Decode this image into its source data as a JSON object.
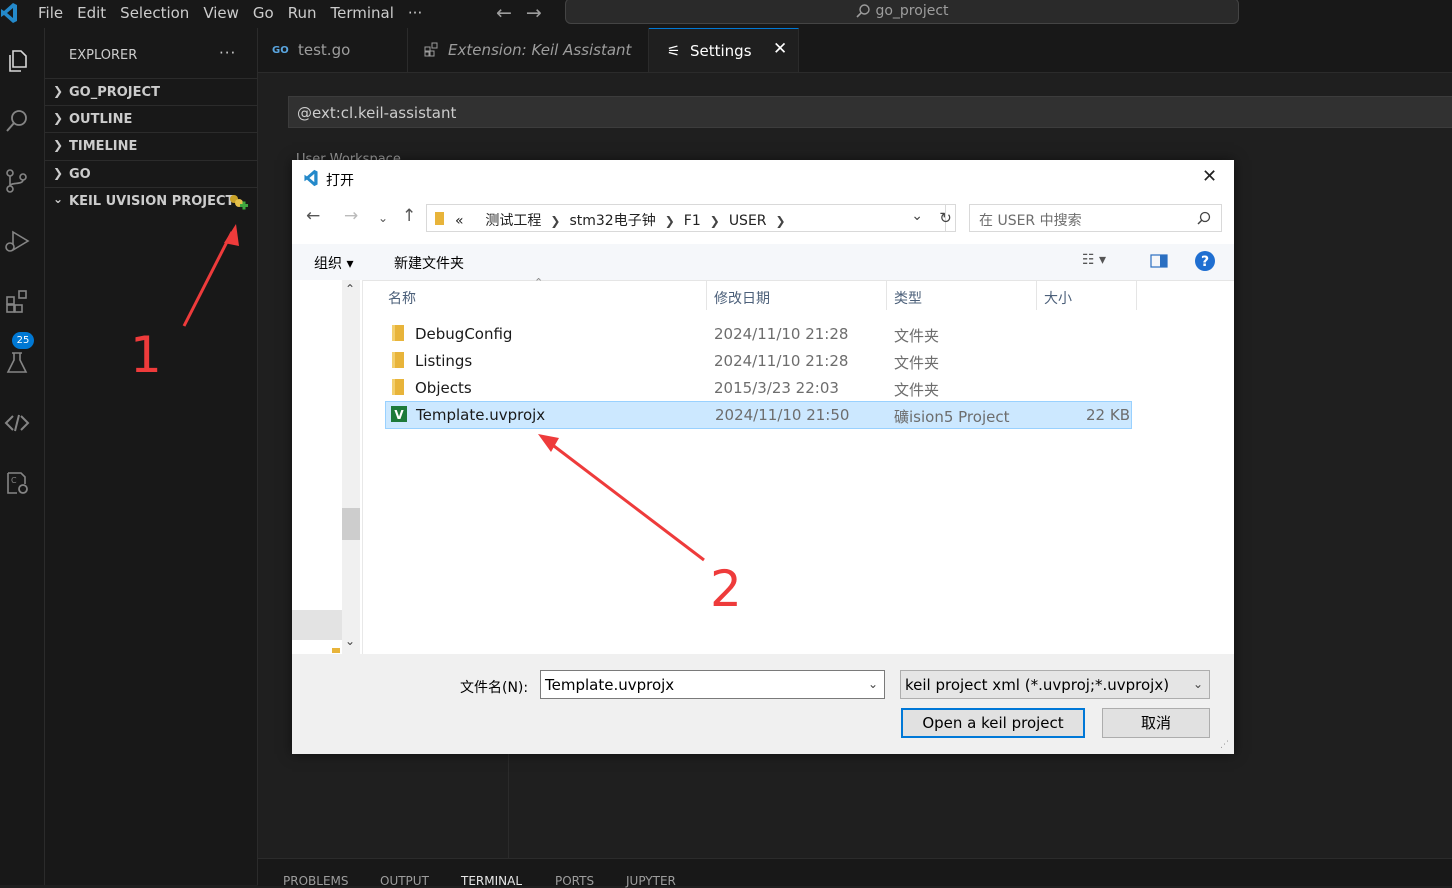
{
  "window": {
    "menu": [
      "File",
      "Edit",
      "Selection",
      "View",
      "Go",
      "Run",
      "Terminal",
      "···"
    ],
    "command_center": "go_project"
  },
  "activity": {
    "extensions_badge": "25"
  },
  "sidebar": {
    "title": "EXPLORER",
    "more": "···",
    "sections": [
      "GO_PROJECT",
      "OUTLINE",
      "TIMELINE",
      "GO",
      "KEIL UVISION PROJECT"
    ]
  },
  "tabs": [
    {
      "label": "test.go",
      "icon": "go-file-icon"
    },
    {
      "label": "Extension: Keil Assistant",
      "icon": "extension-icon"
    },
    {
      "label": "Settings",
      "icon": "settings-icon"
    }
  ],
  "settings": {
    "search_value": "@ext:cl.keil-assistant",
    "scope": "User    Workspace"
  },
  "panel": {
    "tabs": [
      "PROBLEMS",
      "OUTPUT",
      "TERMINAL",
      "PORTS",
      "JUPYTER"
    ],
    "active": "TERMINAL"
  },
  "dialog": {
    "title": "打开",
    "breadcrumbs": [
      "«",
      "测试工程",
      "stm32电子钟",
      "F1",
      "USER"
    ],
    "search_placeholder": "在 USER 中搜索",
    "toolbar": {
      "organize": "组织 ▾",
      "new_folder": "新建文件夹"
    },
    "columns": {
      "name": "名称",
      "modified": "修改日期",
      "type": "类型",
      "size": "大小"
    },
    "files": [
      {
        "name": "DebugConfig",
        "modified": "2024/11/10 21:28",
        "type": "文件夹",
        "size": "",
        "kind": "folder"
      },
      {
        "name": "Listings",
        "modified": "2024/11/10 21:28",
        "type": "文件夹",
        "size": "",
        "kind": "folder"
      },
      {
        "name": "Objects",
        "modified": "2015/3/23 22:03",
        "type": "文件夹",
        "size": "",
        "kind": "folder"
      },
      {
        "name": "Template.uvprojx",
        "modified": "2024/11/10 21:50",
        "type": "礦ision5 Project",
        "size": "22 KB",
        "kind": "uvproj",
        "selected": true
      }
    ],
    "filename_label": "文件名(N):",
    "filename_value": "Template.uvprojx",
    "filetype_value": "keil project xml (*.uvproj;*.uvprojx)",
    "open_button": "Open a keil project",
    "cancel_button": "取消"
  },
  "annotations": [
    "1",
    "2"
  ],
  "colors": {
    "accent": "#0078d4",
    "annotation": "#ee3b3b",
    "selection": "#cce8ff"
  }
}
